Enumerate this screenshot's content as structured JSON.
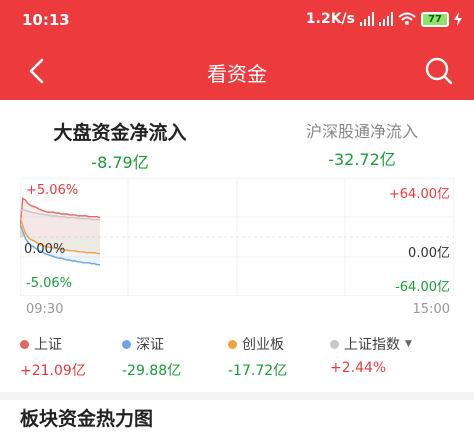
{
  "status_bar": {
    "time": "10:13",
    "net_speed": "1.2K/s",
    "battery": "77"
  },
  "nav": {
    "title": "看资金",
    "back_icon": "chevron-left-icon",
    "search_icon": "search-icon"
  },
  "tabs": [
    {
      "label": "大盘资金净流入",
      "value": "-8.79亿",
      "active": true
    },
    {
      "label": "沪深股通净流入",
      "value": "-32.72亿",
      "active": false
    }
  ],
  "colors": {
    "header": "#ec3a3d",
    "up": "#e83a3d",
    "down": "#1a9c3a",
    "sh": "#e36666",
    "sz": "#6aa6e8",
    "cyb": "#f2a23a",
    "index": "#c8c8c8"
  },
  "chart_data": {
    "type": "line",
    "x_start": "09:30",
    "x_end": "15:00",
    "left_axis": {
      "top": "+5.06%",
      "mid": "0.00%",
      "bottom": "-5.06%"
    },
    "right_axis": {
      "top": "+64.00亿",
      "mid": "0.00亿",
      "bottom": "-64.00亿"
    },
    "ylim": [
      -64,
      64
    ],
    "series": [
      {
        "name": "上证",
        "color": "#e36666",
        "values": [
          10,
          42,
          40,
          36,
          34,
          33,
          32,
          30,
          29,
          28,
          27,
          27,
          27,
          26,
          26,
          25,
          25,
          25,
          24,
          24,
          24,
          23,
          23,
          23,
          23,
          22,
          22,
          22,
          22,
          21
        ]
      },
      {
        "name": "深证",
        "color": "#6aa6e8",
        "values": [
          14,
          6,
          -2,
          -6,
          -9,
          -11,
          -13,
          -15,
          -16,
          -18,
          -19,
          -20,
          -21,
          -22,
          -23,
          -23,
          -24,
          -25,
          -25,
          -26,
          -26,
          -27,
          -27,
          -28,
          -28,
          -28,
          -29,
          -29,
          -30,
          -30
        ]
      },
      {
        "name": "创业板",
        "color": "#f2a23a",
        "values": [
          22,
          12,
          4,
          0,
          -3,
          -4,
          -6,
          -8,
          -9,
          -10,
          -11,
          -11,
          -12,
          -12,
          -13,
          -13,
          -14,
          -14,
          -15,
          -15,
          -15,
          -16,
          -16,
          -16,
          -17,
          -17,
          -17,
          -17,
          -18,
          -18
        ]
      },
      {
        "name": "上证指数",
        "color": "#c8c8c8",
        "values": [
          28,
          30,
          29,
          28,
          27,
          26,
          26,
          25,
          25,
          24,
          24,
          23,
          23,
          23,
          22,
          22,
          22,
          21,
          21,
          21,
          21,
          20,
          20,
          20,
          20,
          20,
          19,
          19,
          19,
          19
        ]
      }
    ]
  },
  "legend": [
    {
      "name": "上证",
      "value": "+21.09亿",
      "color": "#e36666",
      "trend": "up"
    },
    {
      "name": "深证",
      "value": "-29.88亿",
      "color": "#6aa6e8",
      "trend": "down"
    },
    {
      "name": "创业板",
      "value": "-17.72亿",
      "color": "#f2a23a",
      "trend": "down"
    },
    {
      "name": "上证指数",
      "value": "+2.44%",
      "color": "#c8c8c8",
      "trend": "up",
      "has_dropdown": true
    }
  ],
  "bottom": {
    "title": "板块资金热力图"
  }
}
